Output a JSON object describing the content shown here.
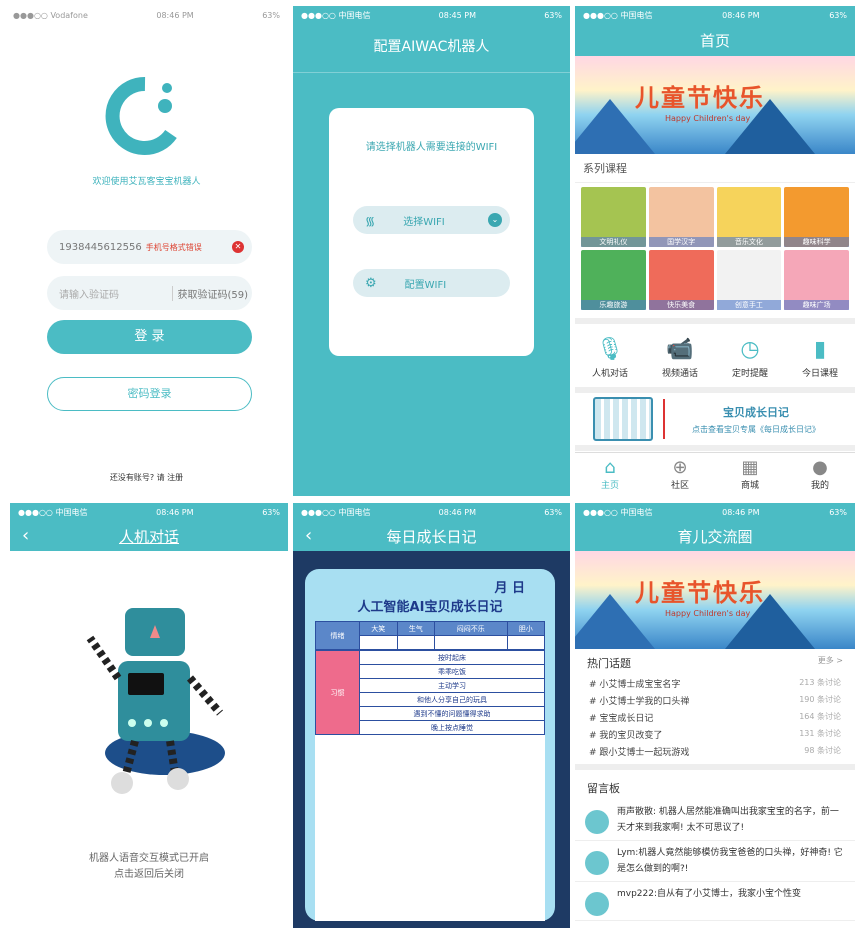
{
  "login": {
    "carrier": "●●●○○ Vodafone",
    "time": "08:46 PM",
    "battery": "63%",
    "welcome": "欢迎使用艾瓦客宝宝机器人",
    "phone": "1938445612556",
    "phone_error": "手机号格式错误",
    "code_placeholder": "请输入验证码",
    "get_code": "获取验证码(59)",
    "login_btn": "登 录",
    "pwd_login": "密码登录",
    "register": "还没有账号? 请 注册"
  },
  "wifi": {
    "carrier": "●●●○○ 中国电信",
    "time": "08:45 PM",
    "battery": "63%",
    "title": "配置AIWAC机器人",
    "prompt": "请选择机器人需要连接的WIFI",
    "select": "选择WIFI",
    "config": "配置WIFI"
  },
  "home": {
    "carrier": "●●●○○ 中国电信",
    "time": "08:46 PM",
    "battery": "63%",
    "title": "首页",
    "banner_title": "儿童节快乐",
    "banner_sub": "Happy Children's day",
    "section": "系列课程",
    "courses": [
      "文明礼仪",
      "国学汉字",
      "音乐文化",
      "趣味科学",
      "乐趣旅游",
      "快乐美食",
      "创意手工",
      "趣味广场"
    ],
    "course_colors": [
      "#a5c451",
      "#f3c3a0",
      "#f6d35b",
      "#f39a2f",
      "#4fb15a",
      "#ef6b5a",
      "#f2f2f2",
      "#f5a7b8"
    ],
    "features": [
      "人机对话",
      "视频通话",
      "定时提醒",
      "今日课程"
    ],
    "diary_title": "宝贝成长日记",
    "diary_sub": "点击查看宝贝专属《每日成长日记》",
    "tabs": [
      "主页",
      "社区",
      "商城",
      "我的"
    ]
  },
  "chat": {
    "carrier": "●●●○○ 中国电信",
    "time": "08:46 PM",
    "battery": "63%",
    "title": "人机对话",
    "notice_1": "机器人语音交互模式已开启",
    "notice_2": "点击返回后关闭"
  },
  "diary": {
    "carrier": "●●●○○ 中国电信",
    "time": "08:46 PM",
    "battery": "63%",
    "title": "每日成长日记",
    "date": "月  日",
    "heading": "人工智能AI宝贝成长日记",
    "mood_label": "情绪",
    "moods": [
      "大笑",
      "生气",
      "闷闷不乐",
      "胆小"
    ],
    "habit_label": "习惯",
    "habits": [
      "按时起床",
      "乖乖吃饭",
      "主动学习",
      "和他人分享自己的玩具",
      "遇到不懂的问题懂得求助",
      "晚上按点睡觉"
    ]
  },
  "community": {
    "carrier": "●●●○○ 中国电信",
    "time": "08:46 PM",
    "battery": "63%",
    "title": "育儿交流圈",
    "banner_title": "儿童节快乐",
    "banner_sub": "Happy Children's day",
    "hot": "热门话题",
    "more": "更多 >",
    "topics": [
      {
        "t": "# 小艾博士成宝宝名字",
        "c": "213 条讨论"
      },
      {
        "t": "# 小艾博士学我的口头禅",
        "c": "190 条讨论"
      },
      {
        "t": "# 宝宝成长日记",
        "c": "164 条讨论"
      },
      {
        "t": "# 我的宝贝改变了",
        "c": "131 条讨论"
      },
      {
        "t": "# 跟小艾博士一起玩游戏",
        "c": "98 条讨论"
      }
    ],
    "board": "留言板",
    "messages": [
      "雨声散散: 机器人居然能准确叫出我家宝宝的名字，前一天才来到我家啊! 太不可思议了!",
      "Lym:机器人竟然能够模仿我宝爸爸的口头禅，好神奇! 它是怎么做到的啊?!",
      "mvp222:自从有了小艾博士，我家小宝个性变"
    ]
  }
}
